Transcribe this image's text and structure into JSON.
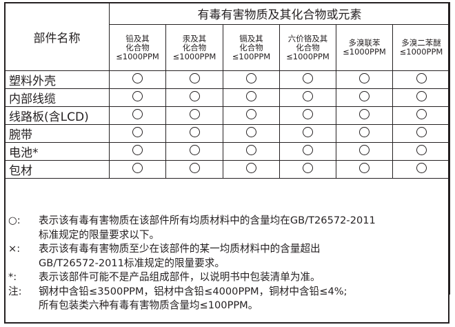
{
  "header": {
    "part_name": "部件名称",
    "group_title": "有毒有害物质及其化合物或元素"
  },
  "substances": [
    {
      "l1": "铅及其",
      "l2": "化合物",
      "l3": "≤1000PPM"
    },
    {
      "l1": "汞及其",
      "l2": "化合物",
      "l3": "≤1000PPM"
    },
    {
      "l1": "镉及其",
      "l2": "化合物",
      "l3": "≤100PPM"
    },
    {
      "l1": "六价铬及其",
      "l2": "化合物",
      "l3": "≤1000PPM"
    },
    {
      "l1": "多溴联苯",
      "l2": "≤1000PPM",
      "l3": ""
    },
    {
      "l1": "多溴二苯醚",
      "l2": "≤1000PPM",
      "l3": ""
    }
  ],
  "parts": [
    {
      "name": "塑料外壳"
    },
    {
      "name": "内部线缆"
    },
    {
      "name": "线路板(含LCD)"
    },
    {
      "name": "腕带"
    },
    {
      "name": "电池*"
    },
    {
      "name": "包材"
    }
  ],
  "mark_name": "circle-mark",
  "notes": {
    "circle_mark": "○:",
    "circle_text_1": "表示该有毒有害物质在该部件所有均质材料中的含量均在GB/T26572-2011",
    "circle_text_2": "标准规定的限量要求以下。",
    "cross_mark": "×:",
    "cross_text_1": "表示该有毒有害物质至少在该部件的某一均质材料中的含量超出",
    "cross_text_2": "GB/T26572-2011标准规定的限量要求。",
    "star_mark": "*:",
    "star_text": "表示该部件可能不是产品组成部件，以说明书中包装清单为准。",
    "note_mark": "注:",
    "note_text_1": "钢材中含铅≤3500PPM，铝材中含铅≤4000PPM，铜材中含铅≤4%;",
    "note_text_2": "所有包装类六种有毒有害物质含量均≤100PPM。"
  }
}
